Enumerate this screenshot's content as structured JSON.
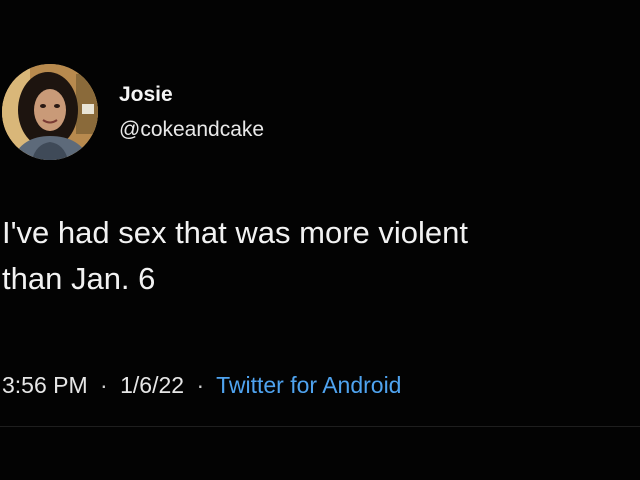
{
  "author": {
    "display_name": "Josie",
    "handle": "@cokeandcake",
    "avatar_icon": "profile-photo"
  },
  "tweet": {
    "text": "I've had sex that was more violent\nthan Jan. 6"
  },
  "meta": {
    "time": "3:56 PM",
    "separator": "·",
    "date": "1/6/22",
    "source": "Twitter for Android"
  },
  "colors": {
    "background": "#000000",
    "text": "#f2f2f2",
    "link": "#4fa3ef"
  }
}
